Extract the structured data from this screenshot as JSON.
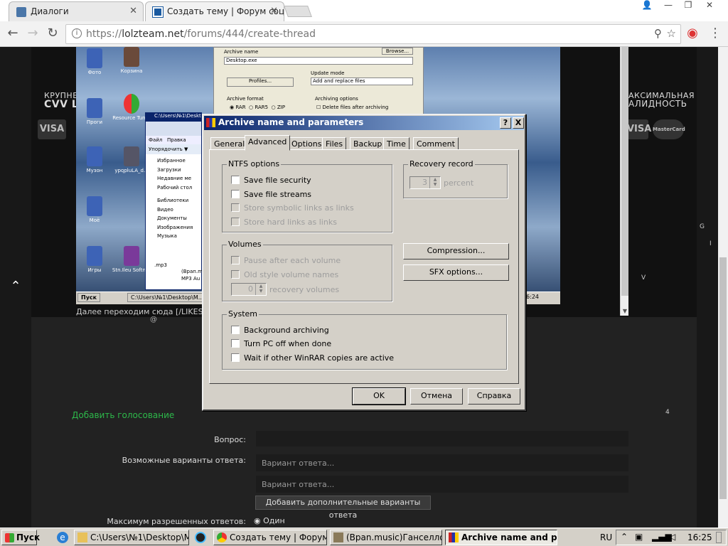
{
  "browser": {
    "tabs": [
      {
        "title": "Диалоги",
        "active": false
      },
      {
        "title": "Создать тему | Форум соц",
        "active": true
      }
    ],
    "url_scheme": "https://",
    "url_host": "lolzteam.net",
    "url_path": "/forums/444/create-thread"
  },
  "page": {
    "banner_left_1": "КРУПНЕ",
    "banner_left_2": "CVV L",
    "banner_right_1": "АКСИМАЛЬНАЯ",
    "banner_right_2": "АЛИДНОСТЬ",
    "visa_label": "VISA",
    "mastercard_label": "MasterCard",
    "below_text": "Далее переходим сюда [/LIKES]",
    "below_at": "@",
    "add_poll": "Добавить голосование",
    "question_label": "Вопрос:",
    "options_label": "Возможные варианты ответа:",
    "option_placeholder": "Вариант ответа...",
    "add_more_options": "Добавить дополнительные варианты ответа",
    "max_answers_label": "Максимум разрешенных ответов:",
    "max_answers_value": "Один",
    "side_g": "G",
    "side_i": "I",
    "side_v": "V",
    "side_4": "4"
  },
  "embedded": {
    "archive_name_label": "Archive name",
    "archive_name_value": "Desktop.exe",
    "browse_label": "Browse...",
    "profiles_label": "Profiles...",
    "update_mode_label": "Update mode",
    "update_mode_value": "Add and replace files",
    "archive_format_label": "Archive format",
    "fmt_rar": "RAR",
    "fmt_rar5": "RAR5",
    "fmt_zip": "ZIP",
    "archiving_options_label": "Archiving options",
    "delete_after": "Delete files after archiving",
    "explorer_title": "C:\\Users\\№1\\Deskto",
    "explorer_menu_file": "Файл",
    "explorer_menu_edit": "Правка",
    "explorer_organize": "Упорядочить ▼",
    "explorer_items": [
      "Избранное",
      "Загрузки",
      "Недавние ме",
      "Рабочий стол",
      "Библиотеки",
      "Видео",
      "Документы",
      "Изображения",
      "Музыка"
    ],
    "mp3_label": ".mp3",
    "file_label_1": "(Врап.m",
    "file_label_2": "MP3 Au",
    "desktop_icons": [
      "Фото",
      "Корзина",
      "Проги",
      "Resource Tuner",
      "Музон",
      "ypqpluLA_d...",
      "Моё",
      "Игры",
      "Stn.Ileu Softnar"
    ],
    "taskbar_start": "Пуск",
    "taskbar_path": "C:\\Users\\№1\\Desktop\\M...",
    "taskbar_time": "16:24"
  },
  "dialog": {
    "title": "Archive name and parameters",
    "help_btn": "?",
    "close_btn": "X",
    "tabs": [
      "General",
      "Advanced",
      "Options",
      "Files",
      "Backup",
      "Time",
      "Comment"
    ],
    "selected_tab": "Advanced",
    "ntfs_title": "NTFS options",
    "ntfs": [
      {
        "label": "Save file security",
        "enabled": true,
        "checked": false
      },
      {
        "label": "Save file streams",
        "enabled": true,
        "checked": false
      },
      {
        "label": "Store symbolic links as links",
        "enabled": false,
        "checked": false
      },
      {
        "label": "Store hard links as links",
        "enabled": false,
        "checked": false
      }
    ],
    "recovery_title": "Recovery record",
    "recovery_value": "3",
    "recovery_unit": "percent",
    "volumes_title": "Volumes",
    "volumes": [
      {
        "label": "Pause after each volume",
        "enabled": false,
        "checked": false
      },
      {
        "label": "Old style volume names",
        "enabled": false,
        "checked": false
      }
    ],
    "recovery_volumes_value": "0",
    "recovery_volumes_label": "recovery volumes",
    "compression_btn": "Compression...",
    "sfx_btn": "SFX options...",
    "system_title": "System",
    "system": [
      {
        "label": "Background archiving",
        "enabled": true,
        "checked": false
      },
      {
        "label": "Turn PC off when done",
        "enabled": true,
        "checked": false
      },
      {
        "label": "Wait if other WinRAR copies are active",
        "enabled": true,
        "checked": false
      }
    ],
    "ok_btn": "OK",
    "cancel_btn": "Отмена",
    "help_text_btn": "Справка"
  },
  "taskbar": {
    "start": "Пуск",
    "items": [
      {
        "label": "C:\\Users\\№1\\Desktop\\M...",
        "active": false
      },
      {
        "label": "Создать тему | Форум с...",
        "active": false
      },
      {
        "label": "(Вpan.music)Ганселло -...",
        "active": false
      },
      {
        "label": "Archive name and pa...",
        "active": true
      }
    ],
    "lang": "RU",
    "time": "16:25"
  },
  "colors": {
    "titlebar_start": "#0a246a",
    "titlebar_end": "#a6caf0",
    "poll_link": "#2db84a",
    "window_face": "#d4d0c8"
  }
}
